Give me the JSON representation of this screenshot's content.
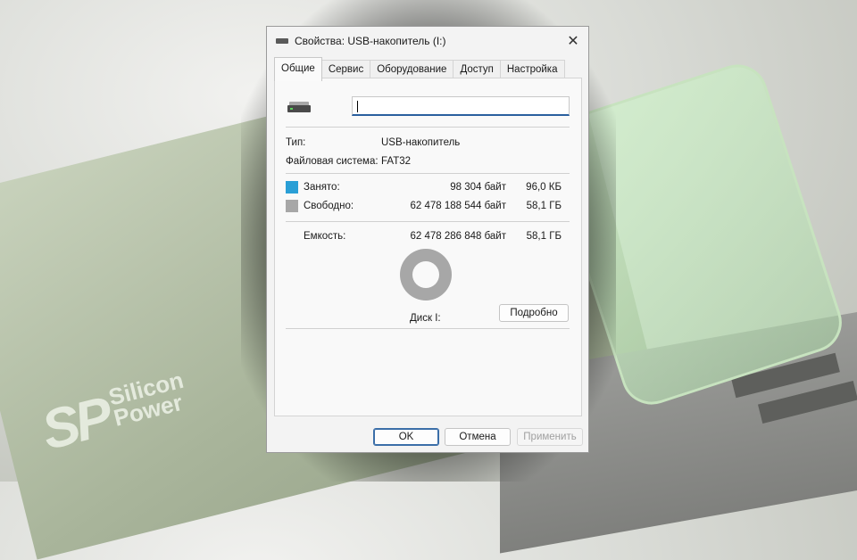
{
  "window": {
    "title": "Свойства: USB-накопитель (I:)",
    "close_glyph": "✕"
  },
  "tabs": [
    {
      "label": "Общие",
      "active": true
    },
    {
      "label": "Сервис",
      "active": false
    },
    {
      "label": "Оборудование",
      "active": false
    },
    {
      "label": "Доступ",
      "active": false
    },
    {
      "label": "Настройка",
      "active": false
    }
  ],
  "general": {
    "name_value": "",
    "type_label": "Тип:",
    "type_value": "USB-накопитель",
    "fs_label": "Файловая система:",
    "fs_value": "FAT32",
    "used_label": "Занято:",
    "used_bytes": "98 304 байт",
    "used_size": "96,0 КБ",
    "free_label": "Свободно:",
    "free_bytes": "62 478 188 544 байт",
    "free_size": "58,1 ГБ",
    "capacity_label": "Емкость:",
    "capacity_bytes": "62 478 286 848 байт",
    "capacity_size": "58,1 ГБ",
    "disk_label": "Диск I:",
    "details_button": "Подробно",
    "used_fraction": 1.6e-06
  },
  "buttons": {
    "ok": "OK",
    "cancel": "Отмена",
    "apply": "Применить"
  },
  "background": {
    "logo_letters": "SP",
    "logo_word1": "Silicon",
    "logo_word2": "Power"
  },
  "colors": {
    "used": "#2a9fd6",
    "free": "#a7a7a7",
    "accent": "#2a5f9e"
  },
  "icons": {
    "drive": "usb-drive-icon",
    "close": "close-icon"
  }
}
